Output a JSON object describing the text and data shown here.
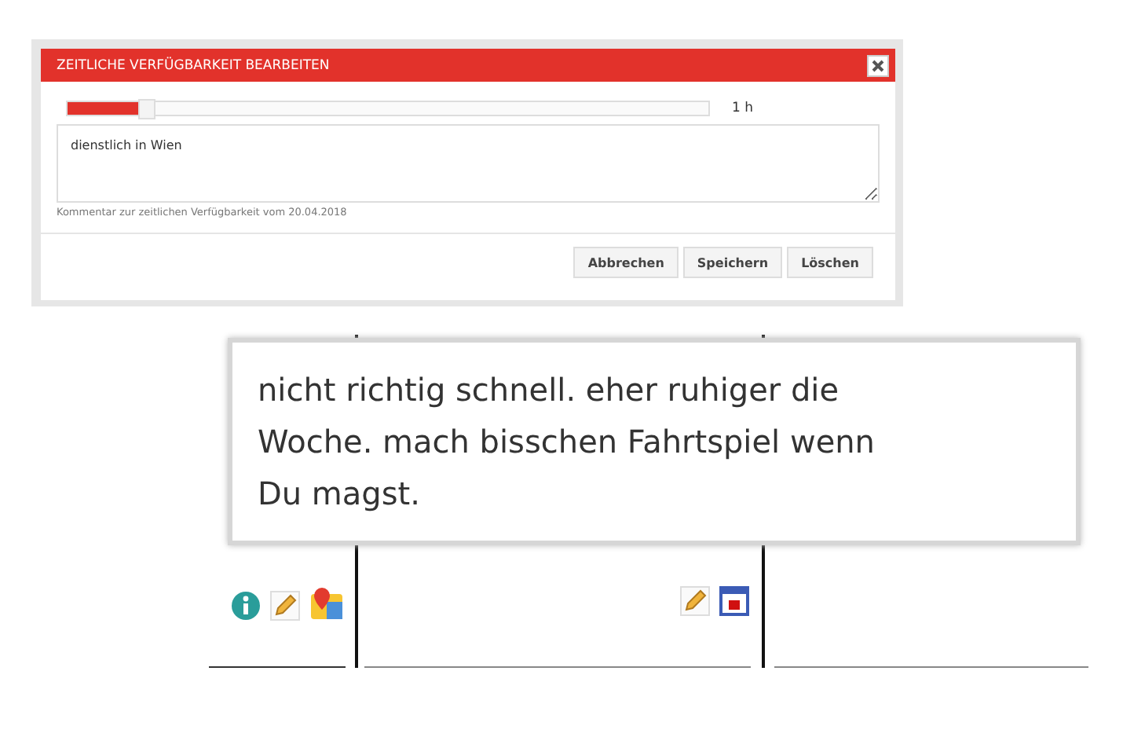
{
  "dialog": {
    "title": "ZEITLICHE VERFÜGBARKEIT BEARBEITEN",
    "slider": {
      "level": 0.11,
      "reading": "1 h"
    },
    "comment": {
      "value": "dienstlich in Wien",
      "caption": "Kommentar zur zeitlichen Verfügbarkeit vom 20.04.2018"
    },
    "buttons": [
      "Abbrechen",
      "Speichern",
      "Löschen"
    ]
  },
  "tooltip": {
    "text": "nicht richtig schnell. eher ruhiger die Woche. mach bisschen Fahrtspiel wenn Du magst."
  }
}
